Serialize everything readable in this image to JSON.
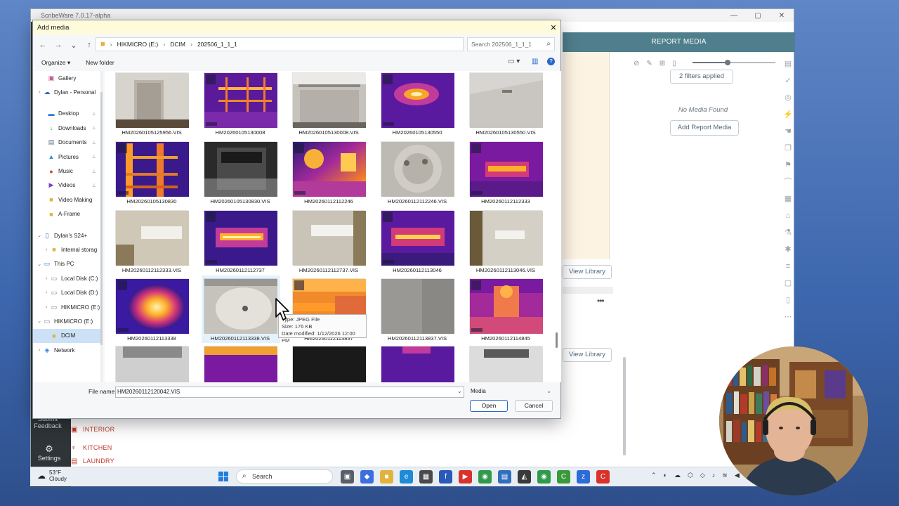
{
  "app": {
    "title": "ScribeWare 7.0.17-alpha",
    "window_controls": [
      "—",
      "▢",
      "✕"
    ],
    "report_media_title": "REPORT MEDIA",
    "filters_applied": "2 filters applied",
    "no_media": "No Media Found",
    "add_report_media": "Add Report Media",
    "view_library": "View Library",
    "submit_feedback": "Submit Feedback",
    "settings": "Settings",
    "rooms": [
      "INTERIOR",
      "KITCHEN",
      "LAUNDRY"
    ],
    "slider_value": 0.42
  },
  "dialog": {
    "title": "Add media",
    "address": {
      "drive": "HIKMICRO (E:)",
      "folder1": "DCIM",
      "folder2": "202506_1_1_1"
    },
    "search_placeholder": "Search 202506_1_1_1",
    "organize": "Organize ▾",
    "new_folder": "New folder",
    "nav": [
      {
        "label": "Gallery",
        "icon": "gallery-icon",
        "glyph": "▣",
        "color": "#c94f8a",
        "chev": "",
        "pin": false
      },
      {
        "label": "Dylan - Personal",
        "icon": "cloud-icon",
        "glyph": "☁",
        "color": "#2a66c9",
        "chev": "›",
        "pin": false
      },
      {
        "label": "",
        "icon": "",
        "glyph": "",
        "color": "",
        "chev": "",
        "pin": false
      },
      {
        "label": "Desktop",
        "icon": "desktop-icon",
        "glyph": "▬",
        "color": "#2a7bd8",
        "chev": "",
        "pin": true
      },
      {
        "label": "Downloads",
        "icon": "downloads-icon",
        "glyph": "↓",
        "color": "#2a9a5a",
        "chev": "",
        "pin": true
      },
      {
        "label": "Documents",
        "icon": "documents-icon",
        "glyph": "▤",
        "color": "#5a6c84",
        "chev": "",
        "pin": true
      },
      {
        "label": "Pictures",
        "icon": "pictures-icon",
        "glyph": "▲",
        "color": "#2a8ed8",
        "chev": "",
        "pin": true
      },
      {
        "label": "Music",
        "icon": "music-icon",
        "glyph": "●",
        "color": "#d2452f",
        "chev": "",
        "pin": true
      },
      {
        "label": "Videos",
        "icon": "videos-icon",
        "glyph": "▶",
        "color": "#7a3cc4",
        "chev": "",
        "pin": true
      },
      {
        "label": "Video Making",
        "icon": "folder-icon",
        "glyph": "■",
        "color": "#e2b33c",
        "chev": "",
        "pin": false
      },
      {
        "label": "A-Frame",
        "icon": "folder-icon",
        "glyph": "■",
        "color": "#e2b33c",
        "chev": "",
        "pin": false
      },
      {
        "label": "",
        "icon": "",
        "glyph": "",
        "color": "",
        "chev": "",
        "pin": false
      },
      {
        "label": "Dylan's S24+",
        "icon": "phone-icon",
        "glyph": "▯",
        "color": "#2a66c9",
        "chev": "⌄",
        "pin": false
      },
      {
        "label": "Internal storag",
        "icon": "folder-icon",
        "glyph": "■",
        "color": "#e2b33c",
        "chev": "›",
        "pin": false
      },
      {
        "label": "This PC",
        "icon": "pc-icon",
        "glyph": "▭",
        "color": "#2a7bd8",
        "chev": "⌄",
        "pin": false
      },
      {
        "label": "Local Disk (C:)",
        "icon": "disk-icon",
        "glyph": "▭",
        "color": "#6b7684",
        "chev": "›",
        "pin": false
      },
      {
        "label": "Local Disk (D:)",
        "icon": "disk-icon",
        "glyph": "▭",
        "color": "#6b7684",
        "chev": "›",
        "pin": false
      },
      {
        "label": "HIKMICRO (E:)",
        "icon": "disk-icon",
        "glyph": "▭",
        "color": "#6b7684",
        "chev": "›",
        "pin": false
      },
      {
        "label": "HIKMICRO (E:)",
        "icon": "disk-icon",
        "glyph": "▭",
        "color": "#6b7684",
        "chev": "⌄",
        "pin": false
      },
      {
        "label": "DCIM",
        "icon": "folder-icon",
        "glyph": "■",
        "color": "#e2b33c",
        "chev": "",
        "pin": false,
        "selected": true
      },
      {
        "label": "Network",
        "icon": "network-icon",
        "glyph": "◈",
        "color": "#2a7bd8",
        "chev": "›",
        "pin": false
      }
    ],
    "files": [
      {
        "name": "HM20260105125956.VIS",
        "kind": "vis-door"
      },
      {
        "name": "HM20260105130008",
        "kind": "thermal-grid"
      },
      {
        "name": "HM20260105130008.VIS",
        "kind": "vis-closet"
      },
      {
        "name": "HM20260105130550",
        "kind": "thermal-spot"
      },
      {
        "name": "HM20260105130550.VIS",
        "kind": "vis-ceiling"
      },
      {
        "name": "HM20260105130830",
        "kind": "thermal-beams"
      },
      {
        "name": "HM20260105130830.VIS",
        "kind": "vis-dark"
      },
      {
        "name": "HM20260112112246",
        "kind": "thermal-fan"
      },
      {
        "name": "HM20260112112246.VIS",
        "kind": "vis-fan"
      },
      {
        "name": "HM20260112112333",
        "kind": "thermal-bar"
      },
      {
        "name": "HM20260112112333.VIS",
        "kind": "vis-ac"
      },
      {
        "name": "HM20260112112737",
        "kind": "thermal-bar2"
      },
      {
        "name": "HM20260112112737.VIS",
        "kind": "vis-ac2"
      },
      {
        "name": "HM20260112113046",
        "kind": "thermal-bar3"
      },
      {
        "name": "HM20260112113046.VIS",
        "kind": "vis-ac3"
      },
      {
        "name": "HM20260112113338",
        "kind": "thermal-hot"
      },
      {
        "name": "HM20260112113338.VIS",
        "kind": "vis-sink",
        "selected": true
      },
      {
        "name": "HM20260112113837",
        "kind": "thermal-orange"
      },
      {
        "name": "HM20260112113837.VIS",
        "kind": "vis-gray"
      },
      {
        "name": "HM20260112114845",
        "kind": "thermal-person"
      },
      {
        "name": "",
        "kind": "vis-partial"
      },
      {
        "name": "",
        "kind": "thermal-partial"
      },
      {
        "name": "",
        "kind": "vis-partial-dark"
      },
      {
        "name": "",
        "kind": "thermal-partial2"
      },
      {
        "name": "",
        "kind": "vis-partial2"
      }
    ],
    "tooltip": {
      "type": "Type: JPEG File",
      "size": "Size: 176 KB",
      "modified": "Date modified: 1/12/2026 12:00 PM"
    },
    "file_name_label": "File name:",
    "file_name_value": "HM20260112120042.VIS",
    "file_type": "Media",
    "open": "Open",
    "cancel": "Cancel",
    "close": "✕"
  },
  "taskbar": {
    "temp": "53°F",
    "condition": "Cloudy",
    "search": "Search"
  }
}
